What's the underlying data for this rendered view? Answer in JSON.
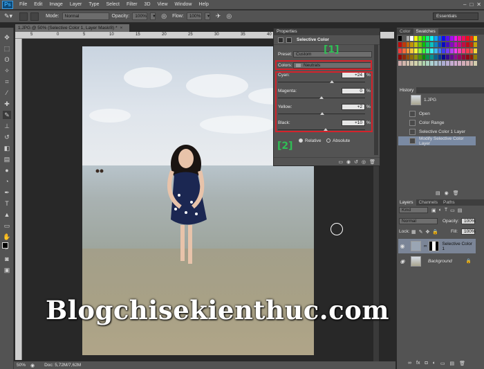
{
  "app": {
    "logo": "Ps"
  },
  "menu": [
    "File",
    "Edit",
    "Image",
    "Layer",
    "Type",
    "Select",
    "Filter",
    "3D",
    "View",
    "Window",
    "Help"
  ],
  "window_controls": [
    "–",
    "□",
    "✕"
  ],
  "options_bar": {
    "mode_label": "Mode:",
    "mode_value": "Normal",
    "opacity_label": "Opacity:",
    "opacity_value": "100%",
    "flow_label": "Flow:",
    "flow_value": "100%",
    "workspace": "Essentials"
  },
  "document_tab": {
    "title": "1.JPG @ 50% (Selective Color 1, Layer Mask/8) *",
    "close": "×"
  },
  "ruler_ticks": [
    "5",
    "0",
    "5",
    "10",
    "15",
    "20",
    "25",
    "30",
    "35",
    "40"
  ],
  "watermark": "Blogchisekienthuc.com",
  "status": {
    "zoom": "50%",
    "doc": "Doc: 5,72M/7,62M"
  },
  "properties": {
    "panel_title": "Properties",
    "adjustment_title": "Selective Color",
    "preset_label": "Preset:",
    "preset_value": "Custom",
    "colors_label": "Colors:",
    "colors_value": "Neutrals",
    "sliders": [
      {
        "label": "Cyan:",
        "value": "+24",
        "unit": "%",
        "level": 0.62
      },
      {
        "label": "Magenta:",
        "value": "0",
        "unit": "%",
        "level": 0.5
      },
      {
        "label": "Yellow:",
        "value": "+2",
        "unit": "%",
        "level": 0.51
      },
      {
        "label": "Black:",
        "value": "+10",
        "unit": "%",
        "level": 0.55
      }
    ],
    "method_relative": "Relative",
    "method_absolute": "Absolute",
    "method_selected": "Relative",
    "annotation_1": "[1]",
    "annotation_2": "[2]",
    "annotation_color": "#2fbf55",
    "highlight_color": "#d4232b"
  },
  "color_panel": {
    "tabs": [
      "Color",
      "Swatches"
    ],
    "active": "Swatches"
  },
  "history": {
    "tab": "History",
    "snapshot": "1.JPG",
    "items": [
      "Open",
      "Color Range",
      "Selective Color 1 Layer",
      "Modify Selective Color Layer"
    ],
    "selected_index": 3
  },
  "layers": {
    "tabs": [
      "Layers",
      "Channels",
      "Paths"
    ],
    "kind_label": "Kind",
    "blend_mode": "Normal",
    "opacity_label": "Opacity:",
    "opacity_value": "100%",
    "lock_label": "Lock:",
    "fill_label": "Fill:",
    "fill_value": "100%",
    "items": [
      {
        "name": "Selective Color 1"
      },
      {
        "name": "Background"
      }
    ]
  }
}
